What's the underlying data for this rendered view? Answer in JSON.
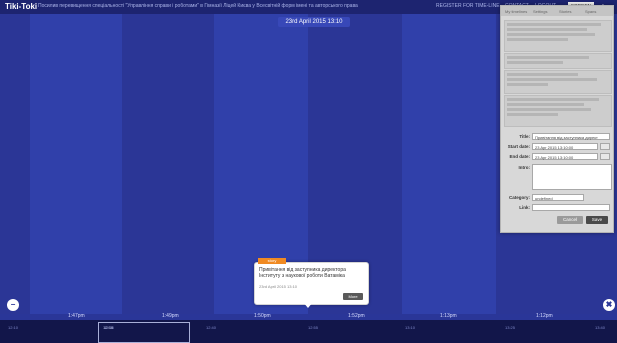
{
  "app": {
    "logo": "Tiki-Toki"
  },
  "header": {
    "title": "Посилив перевищення спеціальності \"Управління справи і роботами\" в Гімназії Ліцей Києва у Всесвітній форм імені та авторського права",
    "nav": [
      "REGISTER FOR TIME-LINE",
      "CONTACT",
      "LOGOUT"
    ],
    "screen_label": "SCREEN"
  },
  "datebar": {
    "label": "23rd April 2015 13:10"
  },
  "timeline": {
    "band_labels": [
      "1:47pm",
      "1:49pm",
      "1:50pm",
      "1:52pm",
      "1:13pm",
      "1:12pm"
    ],
    "ruler_labels": [
      "12:10",
      "12:25",
      "12:40",
      "12:55",
      "13:10",
      "13:25",
      "13:40"
    ],
    "handle_label": "12:58"
  },
  "popup": {
    "tag": "story",
    "text": "Привітання від заступника директора Інституту з наукової роботи Ватаміка",
    "date": "23rd April 2015 13:10",
    "more_label": "More"
  },
  "panel": {
    "tabs": [
      "My timelines",
      "Settings",
      "Stories",
      "Spans"
    ],
    "side_button": "VIEW STEP",
    "form": {
      "title_label": "Title:",
      "title_value": "Привітання від заступника директ",
      "start_label": "Start date:",
      "start_value": "23 Apr 2015 13:10:00",
      "end_label": "End date:",
      "end_value": "23 Apr 2015 13:10:00",
      "intro_label": "Intro:",
      "category_label": "Category:",
      "category_value": "undefined",
      "link_label": "Link:",
      "cancel_label": "Cancel",
      "save_label": "Save"
    }
  },
  "controls": {
    "zoom_out": "−",
    "zoom_in": "✖"
  },
  "colors": {
    "accent": "#f08a22",
    "bg": "#2a3698",
    "band_light": "#3040aa"
  }
}
